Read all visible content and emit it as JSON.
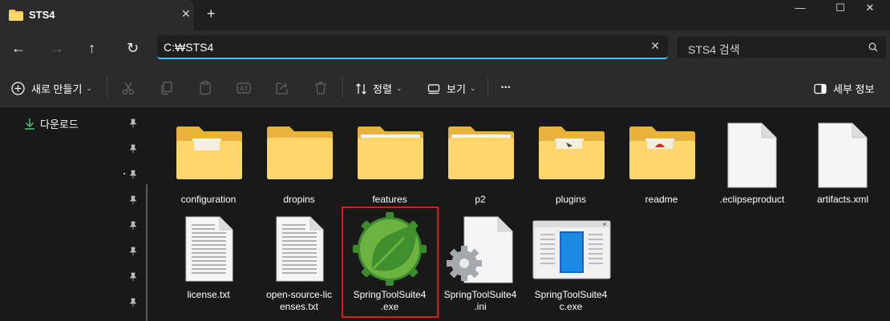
{
  "window": {
    "tab_title": "STS4",
    "tab_close": "✕",
    "new_tab": "+",
    "minimize": "—",
    "maximize": "☐",
    "close": "✕"
  },
  "nav": {
    "back": "←",
    "forward": "→",
    "up": "↑",
    "refresh": "↻",
    "address": "C:₩STS4",
    "clear": "✕",
    "search_placeholder": "STS4 검색"
  },
  "toolbar": {
    "new_label": "새로 만들기",
    "sort_label": "정렬",
    "view_label": "보기",
    "more": "•••",
    "details_label": "세부 정보"
  },
  "sidebar": {
    "items": [
      {
        "label": "다운로드"
      }
    ]
  },
  "files": [
    {
      "name": "configuration",
      "type": "folder"
    },
    {
      "name": "dropins",
      "type": "folder"
    },
    {
      "name": "features",
      "type": "folder"
    },
    {
      "name": "p2",
      "type": "folder"
    },
    {
      "name": "plugins",
      "type": "folder"
    },
    {
      "name": "readme",
      "type": "folder"
    },
    {
      "name": ".eclipseproduct",
      "type": "file"
    },
    {
      "name": "artifacts.xml",
      "type": "file"
    },
    {
      "name": "license.txt",
      "type": "text"
    },
    {
      "name": "open-source-licenses.txt",
      "label_line1": "open-source-lic",
      "label_line2": "enses.txt",
      "type": "text"
    },
    {
      "name": "SpringToolSuite4.exe",
      "label_line1": "SpringToolSuite4",
      "label_line2": ".exe",
      "type": "spring-exe",
      "selected": true
    },
    {
      "name": "SpringToolSuite4.ini",
      "label_line1": "SpringToolSuite4",
      "label_line2": ".ini",
      "type": "ini"
    },
    {
      "name": "SpringToolSuite4c.exe",
      "label_line1": "SpringToolSuite4",
      "label_line2": "c.exe",
      "type": "window-exe"
    }
  ],
  "colors": {
    "accent": "#4cc2ff",
    "folder": "#f8c94a",
    "spring_green": "#6db33f",
    "selection_border": "#e01a1a"
  }
}
